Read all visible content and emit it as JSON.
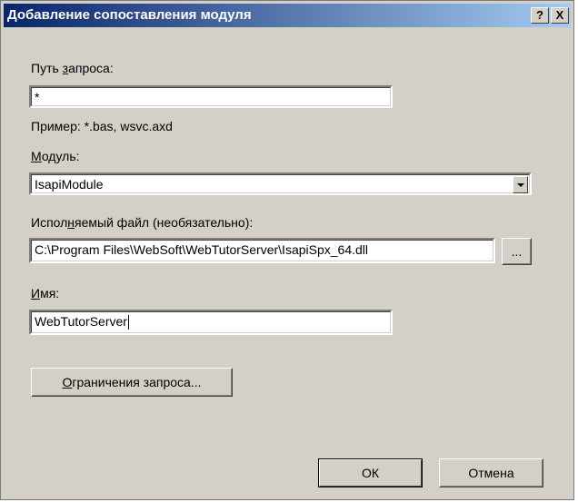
{
  "dialog": {
    "title": "Добавление сопоставления модуля",
    "help_button": "?",
    "close_button": "X"
  },
  "request_path": {
    "label_pre": "Путь ",
    "label_hot": "з",
    "label_post": "апроса:",
    "value": "*",
    "example": "Пример: *.bas, wsvc.axd"
  },
  "module": {
    "label_hot": "М",
    "label_post": "одуль:",
    "selected": "IsapiModule"
  },
  "executable": {
    "label_pre": "Испол",
    "label_hot": "н",
    "label_post": "яемый файл (необязательно):",
    "value": "C:\\Program Files\\WebSoft\\WebTutorServer\\IsapiSpx_64.dll",
    "browse_label": "..."
  },
  "name": {
    "label_hot": "И",
    "label_post": "мя:",
    "value": "WebTutorServer"
  },
  "buttons": {
    "restrictions_hot": "О",
    "restrictions_post": "граничения запроса...",
    "ok": "ОК",
    "cancel": "Отмена"
  }
}
